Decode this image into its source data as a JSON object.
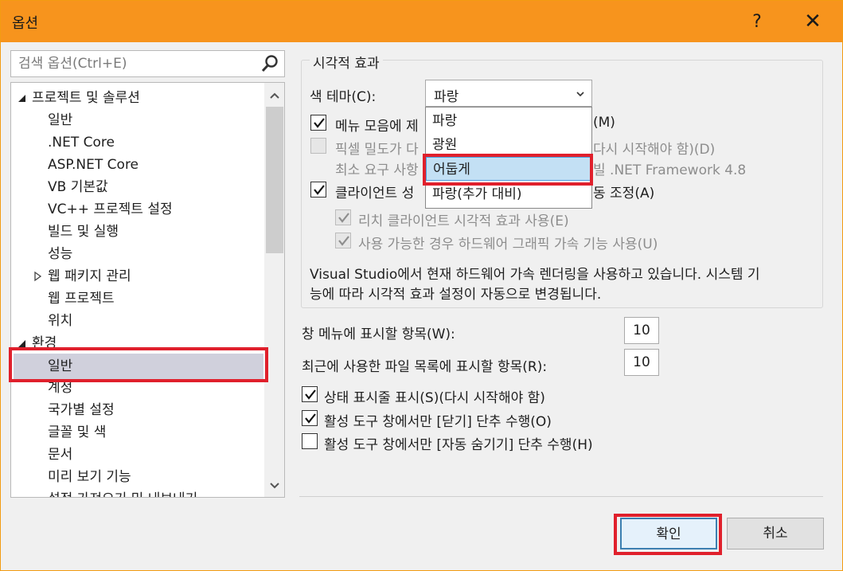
{
  "window": {
    "title": "옵션",
    "help_glyph": "?",
    "close_glyph": "✕"
  },
  "search": {
    "placeholder": "검색 옵션(Ctrl+E)"
  },
  "tree": {
    "items": [
      {
        "label": "프로젝트 및 솔루션",
        "level": 0,
        "expanded": true
      },
      {
        "label": "일반",
        "level": 1
      },
      {
        "label": ".NET Core",
        "level": 1
      },
      {
        "label": "ASP.NET Core",
        "level": 1
      },
      {
        "label": "VB 기본값",
        "level": 1
      },
      {
        "label": "VC++ 프로젝트 설정",
        "level": 1
      },
      {
        "label": "빌드 및 실행",
        "level": 1
      },
      {
        "label": "성능",
        "level": 1
      },
      {
        "label": "웹 패키지 관리",
        "level": 1,
        "expanded": false
      },
      {
        "label": "웹 프로젝트",
        "level": 1
      },
      {
        "label": "위치",
        "level": 1
      },
      {
        "label": "환경",
        "level": 0,
        "expanded": true
      },
      {
        "label": "일반",
        "level": 1,
        "selected": true
      },
      {
        "label": "계정",
        "level": 1
      },
      {
        "label": "국가별 설정",
        "level": 1
      },
      {
        "label": "글꼴 및 색",
        "level": 1
      },
      {
        "label": "문서",
        "level": 1
      },
      {
        "label": "미리 보기 기능",
        "level": 1
      },
      {
        "label": "설정 가져오기 및 내보내기",
        "level": 1
      }
    ]
  },
  "visual_effects": {
    "group_title": "시각적 효과",
    "theme_label": "색 테마(C):",
    "theme_value": "파랑",
    "theme_options": [
      "파랑",
      "광원",
      "어둡게",
      "파랑(추가 대비)"
    ],
    "hovered_option": "어둡게",
    "menu_case": {
      "prefix": "메뉴 모음에 제",
      "suffix": "(M)",
      "checked": true
    },
    "pixel_density": {
      "prefix": "픽셀 밀도가 다",
      "suffix": "다시 시작해야 함)(D)",
      "checked": false,
      "enabled": false
    },
    "min_req": {
      "prefix": "최소 요구 사항",
      "suffix": "빌 .NET Framework 4.8",
      "enabled": false
    },
    "client_perf": {
      "prefix": "클라이언트 성",
      "suffix": "동 조정(A)",
      "checked": true
    },
    "rich_client": {
      "label": "리치 클라이언트 시각적 효과 사용(E)",
      "checked": true,
      "enabled": false
    },
    "hw_accel": {
      "label": "사용 가능한 경우 하드웨어 그래픽 가속 기능 사용(U)",
      "checked": true,
      "enabled": false
    },
    "info_line1": "Visual Studio에서 현재 하드웨어 가속 렌더링을 사용하고 있습니다. 시스템 기",
    "info_line2": "능에 따라 시각적 효과 설정이 자동으로 변경됩니다."
  },
  "window_menu": {
    "label": "창 메뉴에 표시할 항목(W):",
    "value": "10"
  },
  "recent_files": {
    "label": "최근에 사용한 파일 목록에 표시할 항목(R):",
    "value": "10"
  },
  "status_bar": {
    "label": "상태 표시줄 표시(S)(다시 시작해야 함)",
    "checked": true
  },
  "close_button_active": {
    "label": "활성 도구 창에서만 [닫기] 단추 수행(O)",
    "checked": true
  },
  "autohide_active": {
    "label": "활성 도구 창에서만 [자동 숨기기] 단추 수행(H)",
    "checked": false
  },
  "buttons": {
    "ok": "확인",
    "cancel": "취소"
  },
  "colors": {
    "titlebar": "#f7941d",
    "highlight": "#e0202c",
    "hover": "#c3e0f4"
  }
}
